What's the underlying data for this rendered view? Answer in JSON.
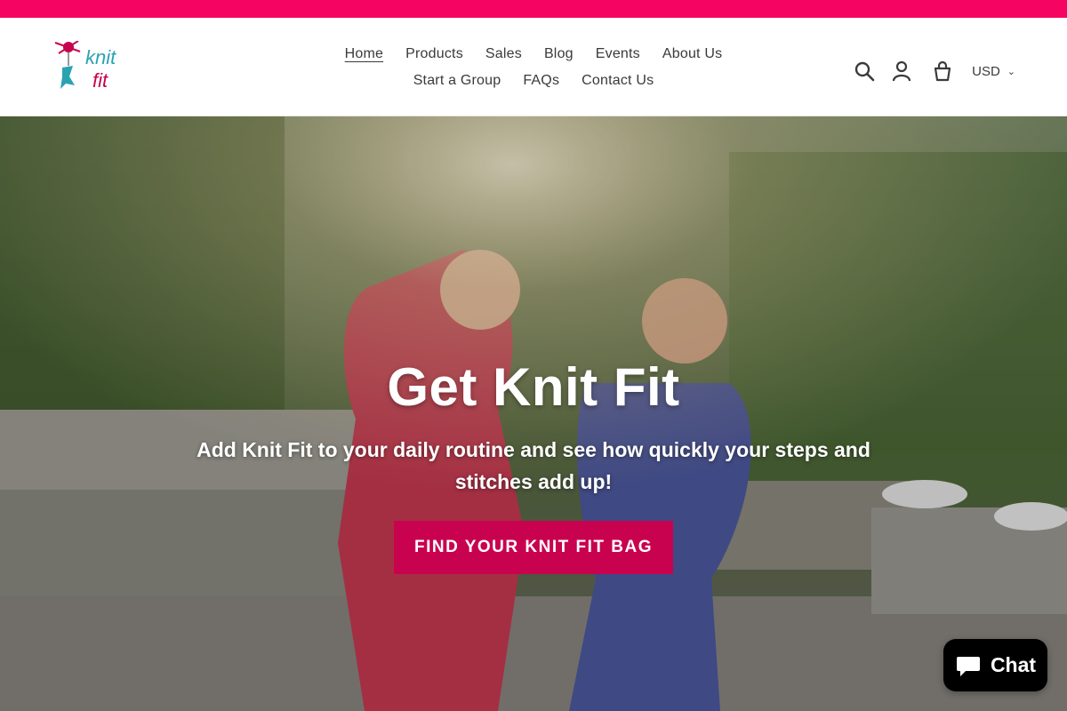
{
  "announcement": {
    "color": "#f50561"
  },
  "logo": {
    "text_top": "knit",
    "text_bottom": "fit",
    "icon": "knitfit-logo-icon"
  },
  "nav": {
    "row1": [
      {
        "label": "Home",
        "active": true
      },
      {
        "label": "Products"
      },
      {
        "label": "Sales"
      },
      {
        "label": "Blog"
      },
      {
        "label": "Events"
      },
      {
        "label": "About Us"
      }
    ],
    "row2": [
      {
        "label": "Start a Group"
      },
      {
        "label": "FAQs"
      },
      {
        "label": "Contact Us"
      }
    ]
  },
  "header_icons": {
    "search": "search-icon",
    "account": "account-icon",
    "cart": "cart-icon"
  },
  "currency": {
    "value": "USD"
  },
  "hero": {
    "title": "Get Knit Fit",
    "subtitle": "Add Knit Fit to your daily routine and see how quickly your steps and stitches add up!",
    "button": "FIND YOUR KNIT FIT BAG",
    "button_color": "#c8024f"
  },
  "chat": {
    "label": "Chat",
    "icon": "chat-bubble-icon"
  }
}
